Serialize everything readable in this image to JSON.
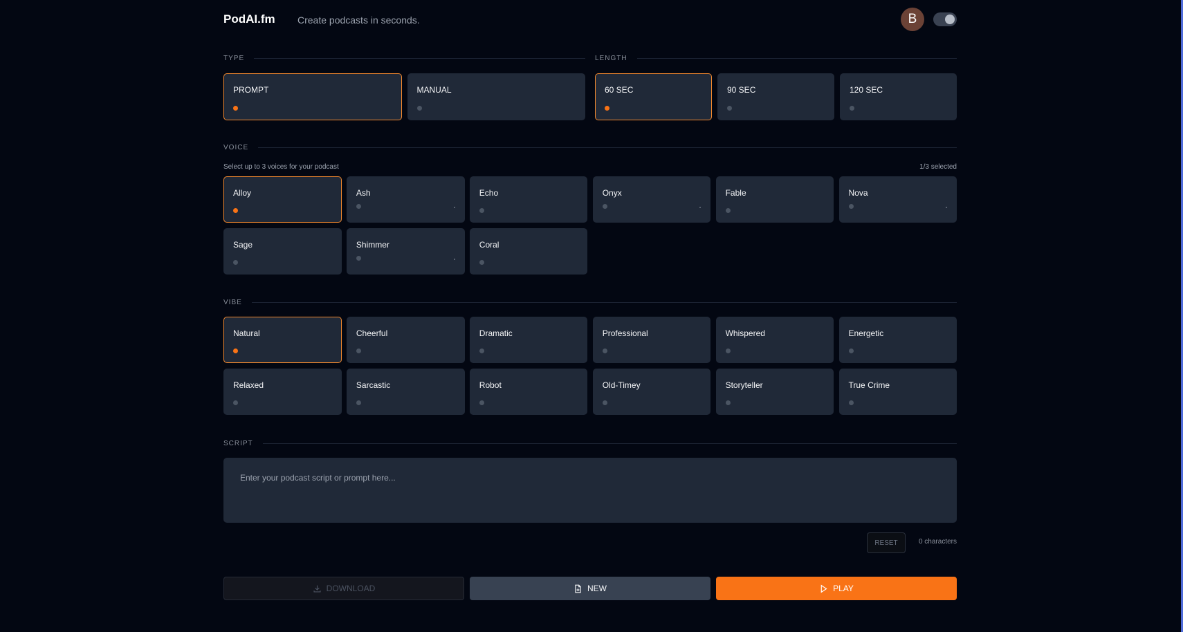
{
  "header": {
    "logo": "PodAI.fm",
    "tagline": "Create podcasts in seconds.",
    "avatar": "B"
  },
  "type": {
    "label": "TYPE",
    "options": [
      {
        "label": "PROMPT",
        "selected": true
      },
      {
        "label": "MANUAL",
        "selected": false
      }
    ]
  },
  "length": {
    "label": "LENGTH",
    "options": [
      {
        "label": "60 SEC",
        "selected": true
      },
      {
        "label": "90 SEC",
        "selected": false
      },
      {
        "label": "120 SEC",
        "selected": false
      }
    ]
  },
  "voice": {
    "label": "VOICE",
    "hint": "Select up to 3 voices for your podcast",
    "count": "1/3 selected",
    "options": [
      {
        "label": "Alloy",
        "selected": true
      },
      {
        "label": "Ash"
      },
      {
        "label": "Echo"
      },
      {
        "label": "Onyx"
      },
      {
        "label": "Fable"
      },
      {
        "label": "Nova"
      },
      {
        "label": "Sage"
      },
      {
        "label": "Shimmer"
      },
      {
        "label": "Coral"
      }
    ]
  },
  "vibe": {
    "label": "VIBE",
    "options": [
      {
        "label": "Natural",
        "selected": true
      },
      {
        "label": "Cheerful"
      },
      {
        "label": "Dramatic"
      },
      {
        "label": "Professional"
      },
      {
        "label": "Whispered"
      },
      {
        "label": "Energetic"
      },
      {
        "label": "Relaxed"
      },
      {
        "label": "Sarcastic"
      },
      {
        "label": "Robot"
      },
      {
        "label": "Old-Timey"
      },
      {
        "label": "Storyteller"
      },
      {
        "label": "True Crime"
      }
    ]
  },
  "script": {
    "label": "SCRIPT",
    "placeholder": "Enter your podcast script or prompt here...",
    "value": "",
    "reset": "RESET",
    "chars": "0 characters"
  },
  "actions": {
    "download": "DOWNLOAD",
    "new": "NEW",
    "play": "PLAY"
  },
  "colors": {
    "accent": "#f97316",
    "background": "#030712",
    "card": "#202938"
  }
}
